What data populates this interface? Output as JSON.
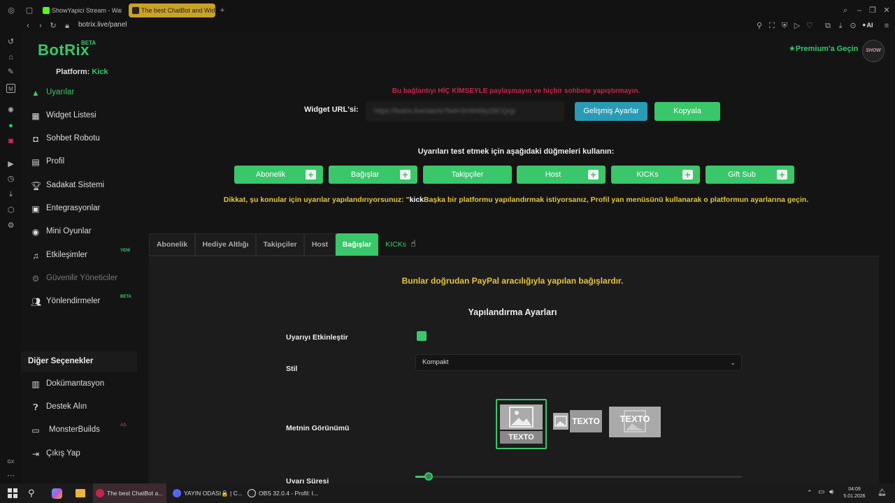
{
  "browser": {
    "tabs": [
      {
        "label": "ShowYapici Stream - Watc",
        "icon": "kick-logo-icon",
        "color": "#53fc18"
      },
      {
        "label": "The best ChatBot and Wid",
        "icon": "botrix-logo-icon",
        "color": "#c9a227",
        "active": true
      }
    ],
    "url": "botrix.live/panel",
    "ai_label": "AI"
  },
  "app": {
    "logo": "BotRix",
    "logo_badge": "BETA",
    "platform_label": "Platform:",
    "platform_value": "Kick",
    "premium_label": "Premium'a Geçin",
    "avatar_text": "SHOW"
  },
  "sidebar": {
    "items": [
      {
        "label": "Uyarılar",
        "icon": "warning-icon",
        "active": true
      },
      {
        "label": "Widget Listesi",
        "icon": "grid-icon"
      },
      {
        "label": "Sohbet Robotu",
        "icon": "robot-icon"
      },
      {
        "label": "Profil",
        "icon": "id-card-icon"
      },
      {
        "label": "Sadakat Sistemi",
        "icon": "trophy-icon"
      },
      {
        "label": "Entegrasyonlar",
        "icon": "integration-icon"
      },
      {
        "label": "Mini Oyunlar",
        "icon": "gamepad-icon"
      },
      {
        "label": "Etkileşimler",
        "icon": "music-icon",
        "badge": "YENİ"
      },
      {
        "label": "Güvenilir Yöneticiler",
        "icon": "gear-icon",
        "disabled": true
      },
      {
        "label": "Yönlendirmeler",
        "icon": "users-icon",
        "badge": "BETA"
      }
    ],
    "other_heading": "Diğer Seçenekler",
    "other_items": [
      {
        "label": "Dokümantasyon",
        "icon": "book-icon"
      },
      {
        "label": "Destek Alın",
        "icon": "help-icon"
      },
      {
        "label": "MonsterBuilds",
        "icon": "laptop-icon",
        "badge": "AD"
      },
      {
        "label": "Çıkış Yap",
        "icon": "logout-icon"
      }
    ]
  },
  "main": {
    "warning": "Bu bağlantıyı HİÇ KİMSEYLE paylaşmayın ve hiçbir sohbete yapıştırmayın.",
    "widget_url_label": "Widget URL'si:",
    "widget_url_value": "https://botrix.live/alerts?bid=0nW4MyZ8CQrgi",
    "advanced_button": "Gelişmiş Ayarlar",
    "copy_button": "Kopyala",
    "test_hint": "Uyarıları test etmek için aşağıdaki düğmeleri kullanın:",
    "test_buttons": [
      "Abonelik",
      "Bağışlar",
      "Takipçiler",
      "Host",
      "KICKs",
      "Gift Sub"
    ],
    "notice_prefix": "Dikkat, şu konular için uyarılar yapılandırıyorsunuz: \"",
    "notice_platform": "kick",
    "notice_suffix": "Başka bir platformu yapılandırmak istiyorsanız, Profil yan menüsünü kullanarak o platformun ayarlarına geçin.",
    "tabs": [
      "Abonelik",
      "Hediye Altlığı",
      "Takipçiler",
      "Host",
      "Bağışlar",
      "KICKs"
    ],
    "active_tab": "Bağışlar",
    "panel": {
      "note": "Bunlar doğrudan PayPal aracılığıyla yapılan bağışlardır.",
      "title": "Yapılandırma Ayarları",
      "enable_label": "Uyarıyı Etkinleştir",
      "enable_checked": true,
      "style_label": "Stil",
      "style_value": "Kompakt",
      "text_view_label": "Metnin Görünümü",
      "style_preview_text": "TEXTO",
      "duration_label": "Uyarı Süresi",
      "duration_fraction": 0.04
    }
  },
  "taskbar": {
    "apps": [
      {
        "label": "The best ChatBot a...",
        "color": "#c2264a"
      },
      {
        "label": "YAYIN ODASI🔒 | C...",
        "color": "#5865f2"
      },
      {
        "label": "OBS 32.0.4 - Profil: I...",
        "color": "#ddd"
      }
    ],
    "time": "04:09",
    "date": "5.01.2026"
  },
  "colors": {
    "accent": "#3ac66a",
    "info": "#2a9bb5",
    "warning_text": "#c2264a",
    "notice_text": "#e3c53b"
  }
}
